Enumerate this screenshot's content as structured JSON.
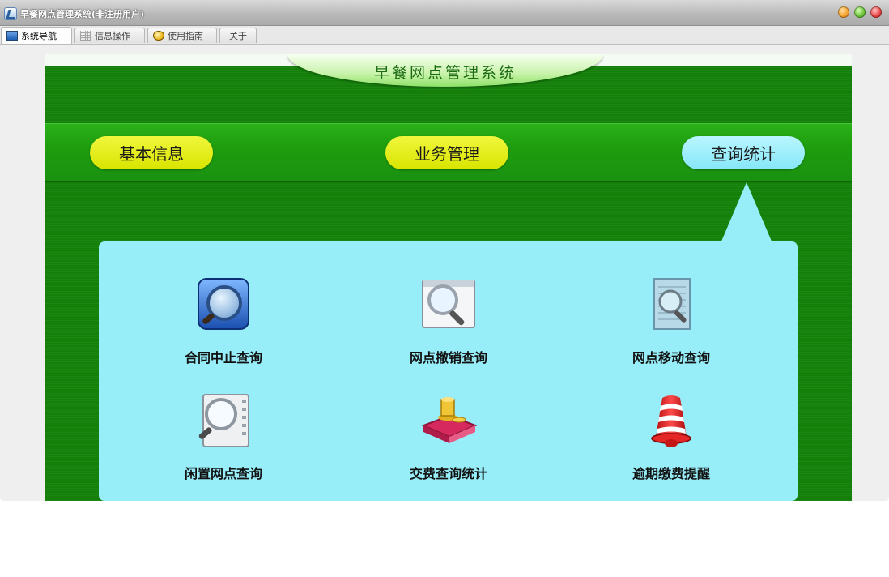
{
  "window": {
    "title": "早餐网点管理系统(非注册用户)",
    "tabs": [
      {
        "label": "系统导航",
        "icon": "monitor-icon",
        "active": true
      },
      {
        "label": "信息操作",
        "icon": "grid-icon",
        "active": false
      },
      {
        "label": "使用指南",
        "icon": "help-icon",
        "active": false
      },
      {
        "label": "关于",
        "icon": "",
        "active": false
      }
    ]
  },
  "header": {
    "title": "早餐网点管理系统"
  },
  "nav": [
    {
      "label": "基本信息",
      "color": "#e6ee14"
    },
    {
      "label": "业务管理",
      "color": "#e6ee14"
    },
    {
      "label": "查询统计",
      "color": "#97edf8",
      "selected": true
    }
  ],
  "panel": {
    "items": [
      {
        "label": "合同中止查询",
        "icon": "blue-magnifier-icon"
      },
      {
        "label": "网点撤销查询",
        "icon": "window-magnifier-icon"
      },
      {
        "label": "网点移动查询",
        "icon": "document-magnifier-icon"
      },
      {
        "label": "闲置网点查询",
        "icon": "film-magnifier-icon"
      },
      {
        "label": "交费查询统计",
        "icon": "money-book-icon"
      },
      {
        "label": "逾期缴费提醒",
        "icon": "alarm-bell-icon"
      }
    ]
  },
  "colors": {
    "background_green": "#14800a",
    "panel_cyan": "#97edf8",
    "pill_yellow": "#e6ee14"
  }
}
